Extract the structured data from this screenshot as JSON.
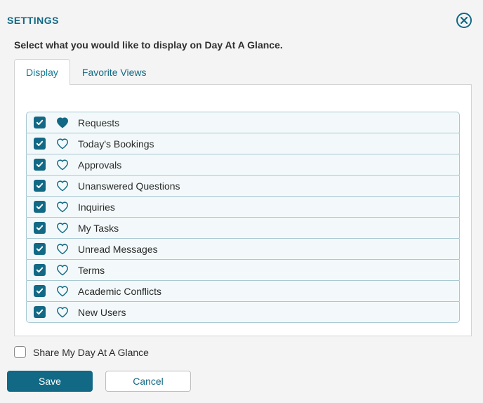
{
  "title": "SETTINGS",
  "subtitle": "Select what you would like to display on Day At A Glance.",
  "tabs": [
    {
      "label": "Display",
      "active": true
    },
    {
      "label": "Favorite Views",
      "active": false
    }
  ],
  "items": [
    {
      "label": "Requests",
      "checked": true,
      "favorite": true
    },
    {
      "label": "Today's Bookings",
      "checked": true,
      "favorite": false
    },
    {
      "label": "Approvals",
      "checked": true,
      "favorite": false
    },
    {
      "label": "Unanswered Questions",
      "checked": true,
      "favorite": false
    },
    {
      "label": "Inquiries",
      "checked": true,
      "favorite": false
    },
    {
      "label": "My Tasks",
      "checked": true,
      "favorite": false
    },
    {
      "label": "Unread Messages",
      "checked": true,
      "favorite": false
    },
    {
      "label": "Terms",
      "checked": true,
      "favorite": false
    },
    {
      "label": "Academic Conflicts",
      "checked": true,
      "favorite": false
    },
    {
      "label": "New Users",
      "checked": true,
      "favorite": false
    }
  ],
  "share": {
    "label": "Share My Day At A Glance",
    "checked": false
  },
  "buttons": {
    "save": "Save",
    "cancel": "Cancel"
  },
  "colors": {
    "accent": "#116985"
  }
}
